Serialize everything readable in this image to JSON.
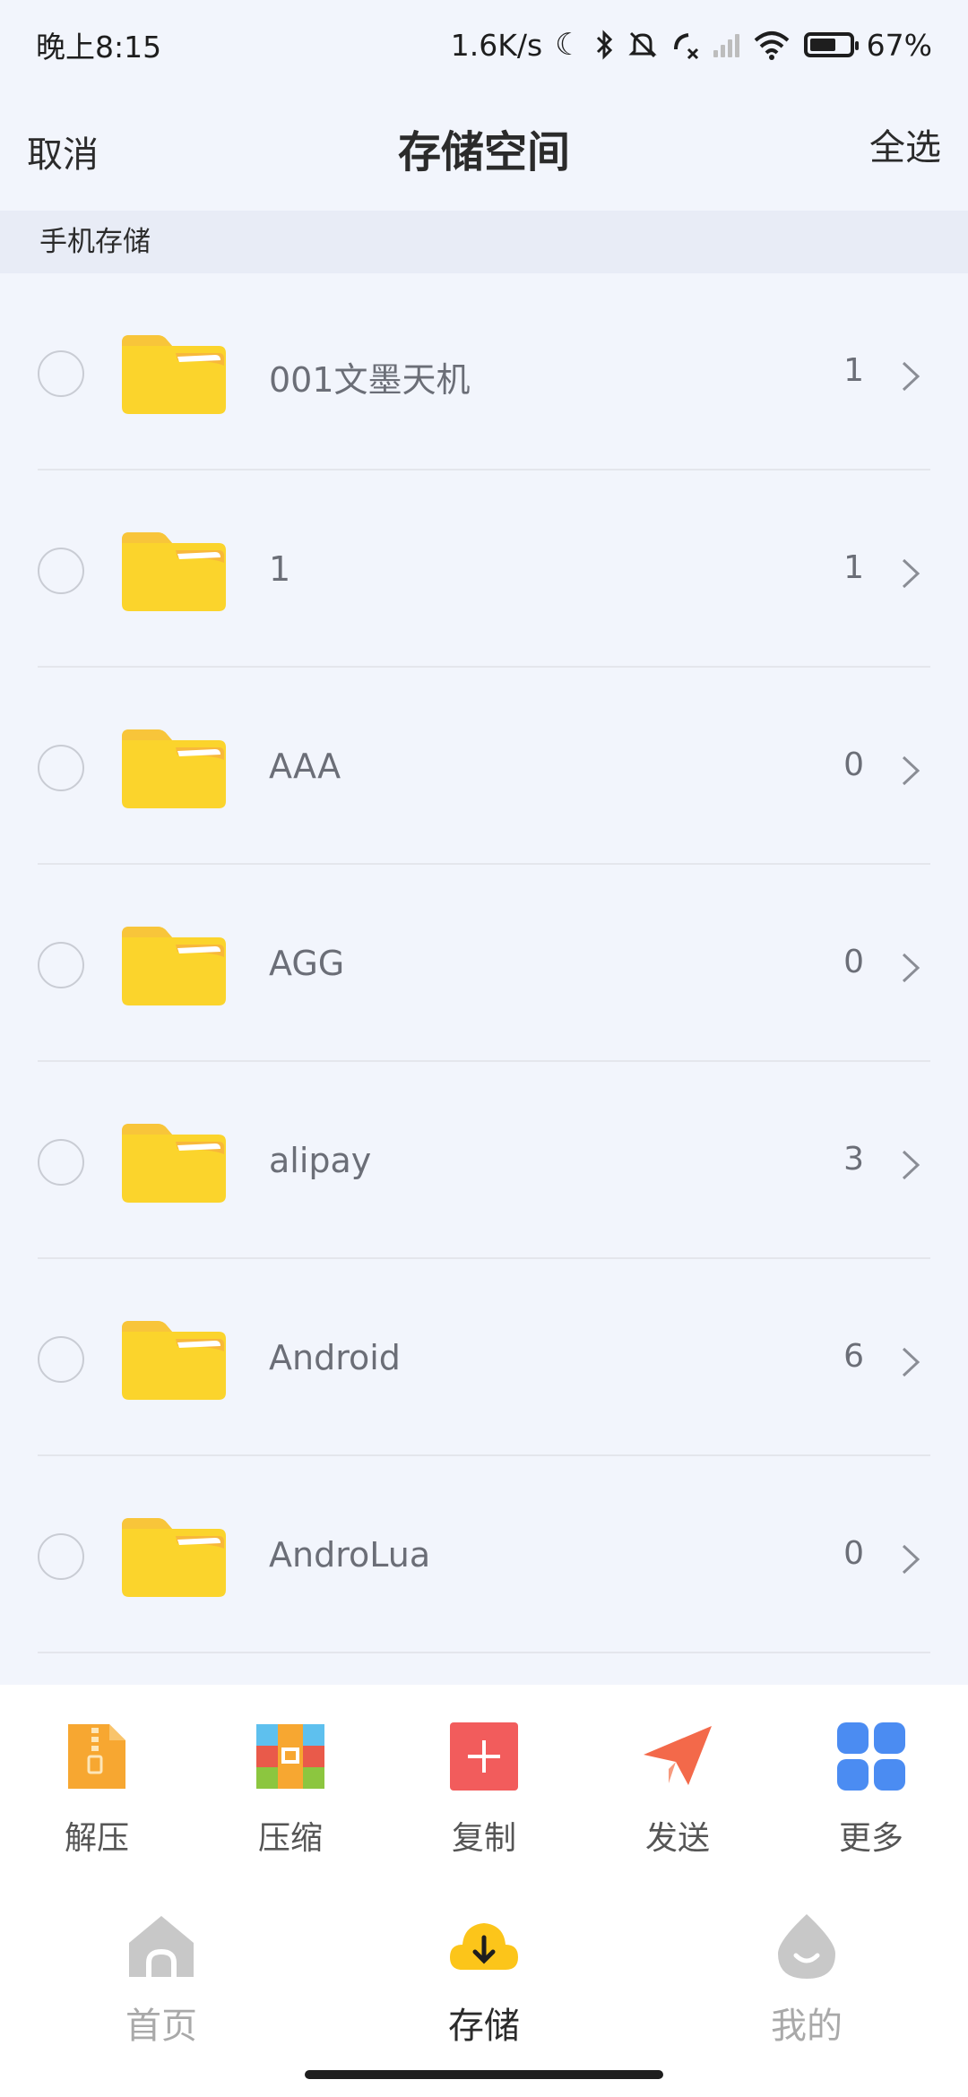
{
  "status_bar": {
    "time": "晚上8:15",
    "net_speed": "1.6K/s",
    "battery": "67%",
    "battery_level": 0.67,
    "icons": [
      "moon-icon",
      "bluetooth-icon",
      "bell-muted-icon",
      "call-icon",
      "signal-icon",
      "wifi-icon",
      "battery-icon"
    ]
  },
  "header": {
    "cancel_label": "取消",
    "title": "存储空间",
    "select_all_label": "全选"
  },
  "section": {
    "title": "手机存储"
  },
  "files": [
    {
      "name": "001文墨天机",
      "count": "1"
    },
    {
      "name": "1",
      "count": "1"
    },
    {
      "name": "AAA",
      "count": "0"
    },
    {
      "name": "AGG",
      "count": "0"
    },
    {
      "name": "alipay",
      "count": "3"
    },
    {
      "name": "Android",
      "count": "6"
    },
    {
      "name": "AndroLua",
      "count": "0"
    }
  ],
  "actions": [
    {
      "label": "解压",
      "icon": "unzip-icon",
      "color": "#f7a731"
    },
    {
      "label": "压缩",
      "icon": "compress-icon",
      "color": "#e95a4a"
    },
    {
      "label": "复制",
      "icon": "copy-icon",
      "color": "#f25c5c"
    },
    {
      "label": "发送",
      "icon": "send-icon",
      "color": "#f3694a"
    },
    {
      "label": "更多",
      "icon": "more-icon",
      "color": "#4b8cf2"
    }
  ],
  "bottom_nav": [
    {
      "label": "首页",
      "icon": "home-icon",
      "active": false
    },
    {
      "label": "存储",
      "icon": "cloud-download-icon",
      "active": true
    },
    {
      "label": "我的",
      "icon": "profile-icon",
      "active": false
    }
  ],
  "colors": {
    "background": "#f2f5fc",
    "folder": "#fbd42c",
    "folder_tab": "#f8b83a",
    "accent": "#fcc51a"
  }
}
